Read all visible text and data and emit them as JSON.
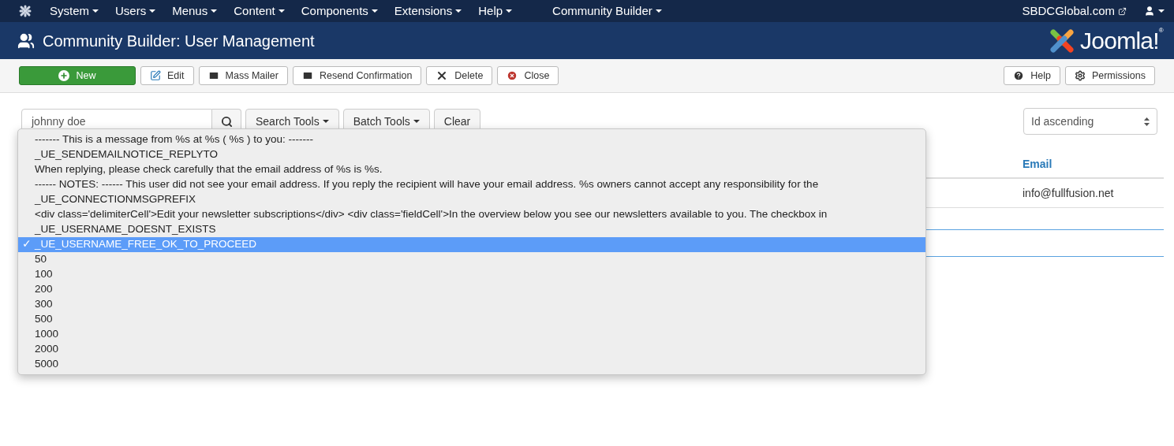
{
  "top_menu": [
    {
      "label": "System"
    },
    {
      "label": "Users"
    },
    {
      "label": "Menus"
    },
    {
      "label": "Content"
    },
    {
      "label": "Components"
    },
    {
      "label": "Extensions"
    },
    {
      "label": "Help"
    },
    {
      "label": "Community Builder"
    }
  ],
  "site_link": "SBDCGlobal.com",
  "header": {
    "title": "Community Builder: User Management",
    "logo_text": "Joomla!",
    "logo_mark": "®"
  },
  "toolbar": [
    {
      "label": "New",
      "kind": "new"
    },
    {
      "label": "Edit",
      "kind": "edit"
    },
    {
      "label": "Mass Mailer",
      "kind": "mail"
    },
    {
      "label": "Resend Confirmation",
      "kind": "mail"
    },
    {
      "label": "Delete",
      "kind": "delete"
    },
    {
      "label": "Close",
      "kind": "close"
    }
  ],
  "toolbar_right": [
    {
      "label": "Help",
      "kind": "help"
    },
    {
      "label": "Permissions",
      "kind": "gear"
    }
  ],
  "filters": {
    "search_value": "johnny doe",
    "buttons": [
      {
        "label": "Search Tools",
        "kind": "menu"
      },
      {
        "label": "Batch Tools",
        "kind": "menu"
      },
      {
        "label": "Clear",
        "kind": "plain"
      }
    ],
    "ordering": "Id ascending"
  },
  "table": {
    "email_header": "Email",
    "rows": [
      {
        "email": "info@fullfusion.net"
      }
    ]
  },
  "dropdown": {
    "check_mark": "✓",
    "options": [
      {
        "label": "------- This is a message from %s at %s ( %s ) to you: -------",
        "selected": false
      },
      {
        "label": "_UE_SENDEMAILNOTICE_REPLYTO",
        "selected": false
      },
      {
        "label": "When replying, please check carefully that the email address of %s is %s.",
        "selected": false
      },
      {
        "label": "------ NOTES: ------ This user did not see your email address. If you reply the recipient will have your email address. %s owners cannot accept any responsibility for the",
        "selected": false
      },
      {
        "label": "_UE_CONNECTIONMSGPREFIX",
        "selected": false
      },
      {
        "label": "<div class='delimiterCell'>Edit your newsletter subscriptions</div> <div class='fieldCell'>In the overview below you see our newsletters available to you. The checkbox in",
        "selected": false
      },
      {
        "label": "_UE_USERNAME_DOESNT_EXISTS",
        "selected": false
      },
      {
        "label": "_UE_USERNAME_FREE_OK_TO_PROCEED",
        "selected": true
      },
      {
        "label": "50",
        "selected": false
      },
      {
        "label": "100",
        "selected": false
      },
      {
        "label": "200",
        "selected": false
      },
      {
        "label": "300",
        "selected": false
      },
      {
        "label": "500",
        "selected": false
      },
      {
        "label": "1000",
        "selected": false
      },
      {
        "label": "2000",
        "selected": false
      },
      {
        "label": "5000",
        "selected": false
      }
    ]
  }
}
